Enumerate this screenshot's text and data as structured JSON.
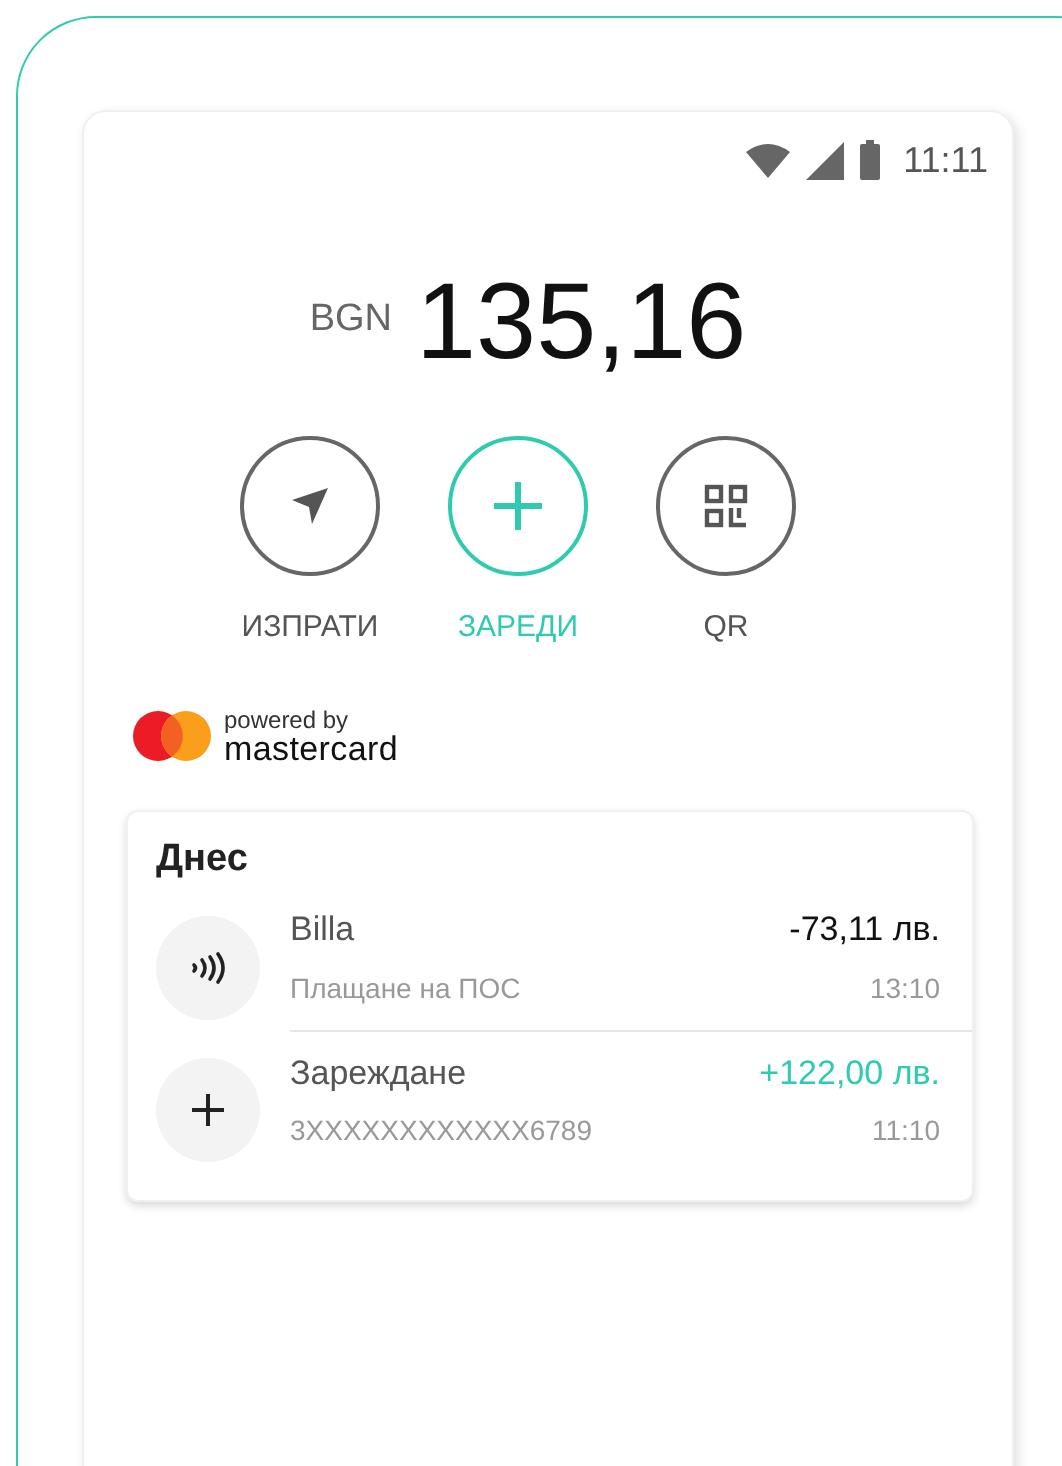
{
  "status_bar": {
    "time": "11:11"
  },
  "balance": {
    "currency": "BGN",
    "amount": "135,16"
  },
  "actions": [
    {
      "kind": "send",
      "label": "ИЗПРАТИ",
      "selected": false
    },
    {
      "kind": "topup",
      "label": "ЗАРЕДИ",
      "selected": true
    },
    {
      "kind": "qr",
      "label": "QR",
      "selected": false
    }
  ],
  "partner": {
    "caption": "powered by",
    "brand": "mastercard"
  },
  "history": {
    "title": "Днес",
    "transactions": [
      {
        "kind": "contactless",
        "name": "Billa",
        "detail": "Плащане на ПОС",
        "amount": "-73,11 лв.",
        "time": "13:10",
        "credit": false
      },
      {
        "kind": "topup",
        "name": "Зареждане",
        "detail": "3XXXXXXXXXXXX6789",
        "amount": "+122,00 лв.",
        "time": "11:10",
        "credit": true
      }
    ]
  }
}
